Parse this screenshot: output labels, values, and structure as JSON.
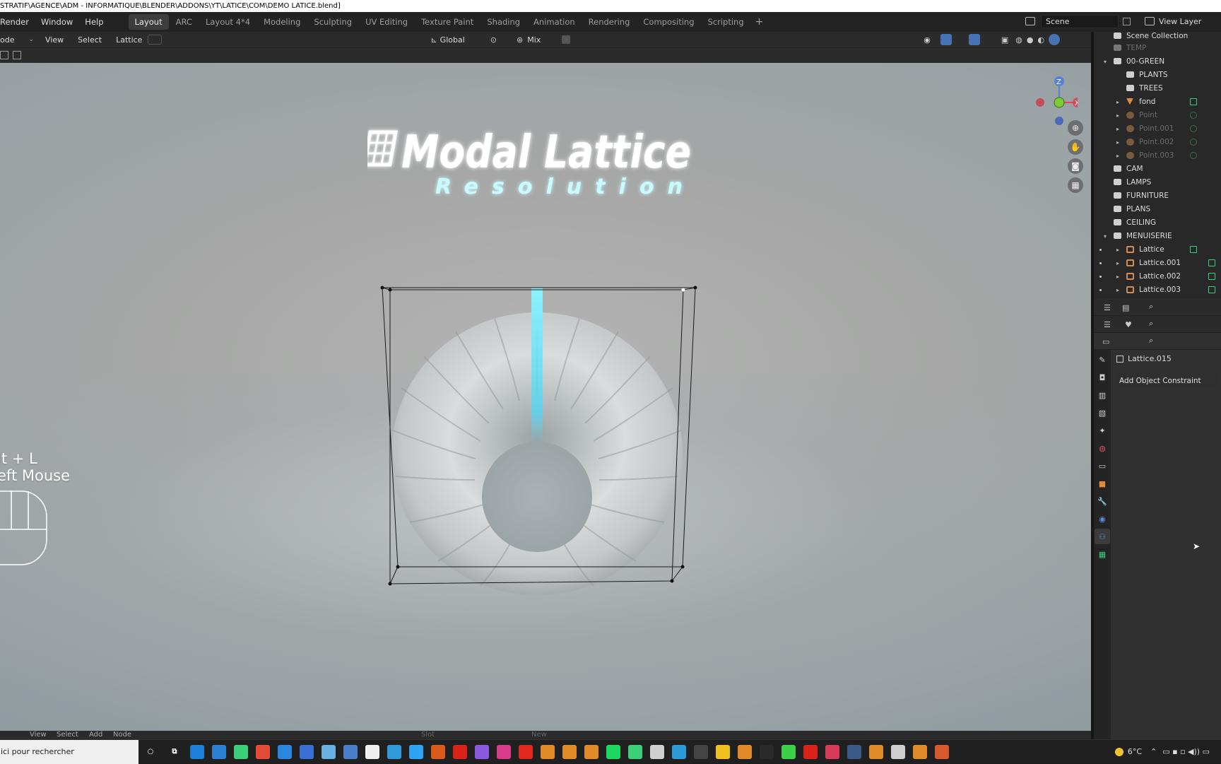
{
  "window": {
    "title": "STRATIF\\AGENCE\\ADM - INFORMATIQUE\\BLENDER\\ADDONS\\YT\\LATICE\\COM\\DEMO LATICE.blend]"
  },
  "topbar": {
    "menus": [
      "Render",
      "Window",
      "Help"
    ],
    "tabs": [
      "Layout",
      "ARC",
      "Layout 4*4",
      "Modeling",
      "Sculpting",
      "UV Editing",
      "Texture Paint",
      "Shading",
      "Animation",
      "Rendering",
      "Compositing",
      "Scripting"
    ],
    "active_tab": "Layout",
    "add_tab": "+",
    "scene_value": "Scene",
    "view_layer_value": "View Layer"
  },
  "viewport_header": {
    "mode": "ode",
    "menus": [
      "View",
      "Select",
      "Lattice"
    ],
    "orientation": "Global",
    "pivot_mix": "Mix"
  },
  "viewport": {
    "logo_line1": "Modal Lattice",
    "logo_line2": "Resolution",
    "hint_line1": "lt + L",
    "hint_line2": "eft Mouse",
    "gizmo": {
      "z": "Z",
      "x": "X"
    }
  },
  "bottom_header": {
    "menus": [
      "View",
      "Select",
      "Add",
      "Node"
    ],
    "slot": "Slot",
    "new": "New"
  },
  "outliner": {
    "root": "Scene Collection",
    "rows": [
      {
        "label": "TEMP",
        "depth": 1,
        "kind": "collection",
        "dim": true,
        "arrow": ""
      },
      {
        "label": "00-GREEN",
        "depth": 1,
        "kind": "collection",
        "dim": false,
        "arrow": "▾"
      },
      {
        "label": "PLANTS",
        "depth": 2,
        "kind": "collection",
        "dim": false,
        "arrow": ""
      },
      {
        "label": "TREES",
        "depth": 2,
        "kind": "collection",
        "dim": false,
        "arrow": ""
      },
      {
        "label": "fond",
        "depth": 2,
        "kind": "mesh",
        "dim": false,
        "arrow": "▸"
      },
      {
        "label": "Point",
        "depth": 2,
        "kind": "light",
        "dim": true,
        "arrow": "▸"
      },
      {
        "label": "Point.001",
        "depth": 2,
        "kind": "light",
        "dim": true,
        "arrow": "▸"
      },
      {
        "label": "Point.002",
        "depth": 2,
        "kind": "light",
        "dim": true,
        "arrow": "▸"
      },
      {
        "label": "Point.003",
        "depth": 2,
        "kind": "light",
        "dim": true,
        "arrow": "▸"
      },
      {
        "label": "CAM",
        "depth": 1,
        "kind": "collection",
        "dim": false,
        "arrow": ""
      },
      {
        "label": "LAMPS",
        "depth": 1,
        "kind": "collection",
        "dim": false,
        "arrow": ""
      },
      {
        "label": "FURNITURE",
        "depth": 1,
        "kind": "collection",
        "dim": false,
        "arrow": ""
      },
      {
        "label": "PLANS",
        "depth": 1,
        "kind": "collection",
        "dim": false,
        "arrow": ""
      },
      {
        "label": "CEILING",
        "depth": 1,
        "kind": "collection",
        "dim": false,
        "arrow": ""
      },
      {
        "label": "MENUISERIE",
        "depth": 1,
        "kind": "collection",
        "dim": false,
        "arrow": "▾"
      },
      {
        "label": "Lattice",
        "depth": 2,
        "kind": "lattice",
        "dim": false,
        "arrow": "▸"
      },
      {
        "label": "Lattice.001",
        "depth": 2,
        "kind": "lattice",
        "dim": false,
        "arrow": "▸"
      },
      {
        "label": "Lattice.002",
        "depth": 2,
        "kind": "lattice",
        "dim": false,
        "arrow": "▸"
      },
      {
        "label": "Lattice.003",
        "depth": 2,
        "kind": "lattice",
        "dim": false,
        "arrow": "▸"
      }
    ]
  },
  "properties": {
    "object_name": "Lattice.015",
    "add_constraint": "Add Object Constraint"
  },
  "taskbar": {
    "search_placeholder": "ici pour rechercher",
    "temperature": "6°C",
    "apps": [
      "edge",
      "vscode",
      "3d",
      "chrome",
      "teamviewer",
      "bag",
      "notepad",
      "calc",
      "blender-logo",
      "app",
      "photoshop",
      "animate",
      "acrobat",
      "aftereffects",
      "indesign",
      "autocad",
      "blender",
      "blender",
      "blender",
      "spotify",
      "3d",
      "unreal",
      "store",
      "epic",
      "maya",
      "blender",
      "steam",
      "play",
      "red",
      "app",
      "k",
      "blender",
      "files",
      "blender",
      "app"
    ]
  },
  "colors": {
    "accent": "#4772b3",
    "lattice_icon": "#d98b4c",
    "collection_icon": "#cfcfcf",
    "light_glow": "#7ee9ff"
  }
}
